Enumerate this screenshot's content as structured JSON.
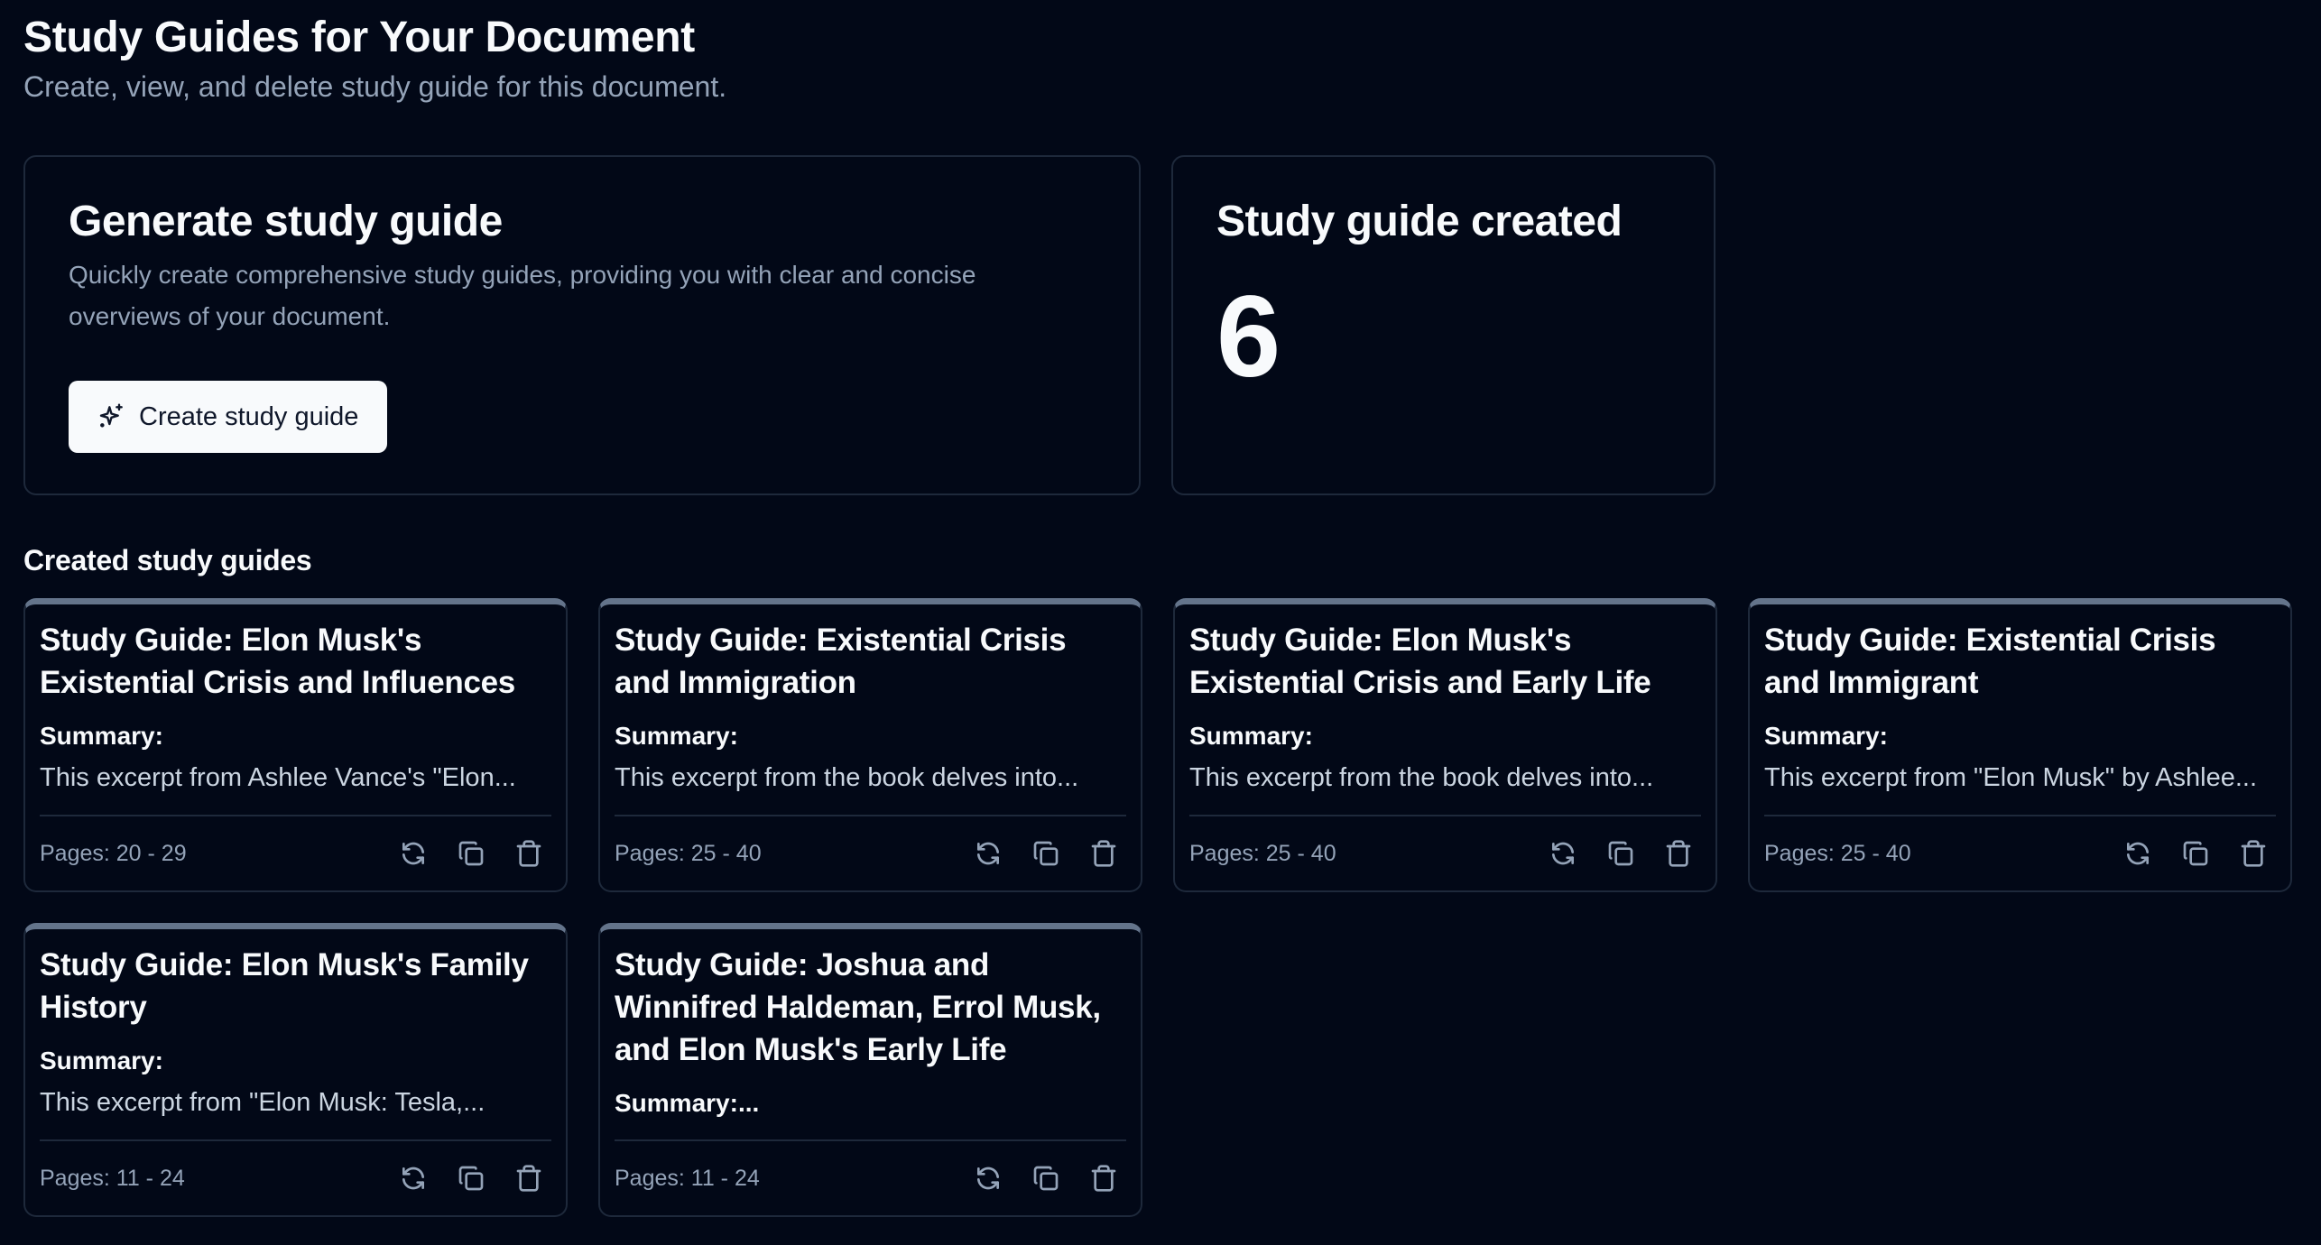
{
  "header": {
    "title": "Study Guides for Your Document",
    "subtitle": "Create, view, and delete study guide for this document."
  },
  "generate": {
    "title": "Generate study guide",
    "description": "Quickly create comprehensive study guides, providing you with clear and concise overviews of your document.",
    "button_label": "Create study guide",
    "button_icon": "sparkles-icon"
  },
  "stats": {
    "title": "Study guide created",
    "count": "6"
  },
  "list": {
    "heading": "Created study guides",
    "summary_label": "Summary:",
    "actions": [
      "regenerate-icon",
      "copy-icon",
      "delete-icon"
    ],
    "guides": [
      {
        "title": "Study Guide: Elon Musk's Existential Crisis and Influences",
        "summary_label": "Summary:",
        "summary": "This excerpt from Ashlee Vance's \"Elon...",
        "pages": "Pages: 20 - 29"
      },
      {
        "title": "Study Guide: Existential Crisis and Immigration",
        "summary_label": "Summary:",
        "summary": "This excerpt from the book delves into...",
        "pages": "Pages: 25 - 40"
      },
      {
        "title": "Study Guide: Elon Musk's Existential Crisis and Early Life",
        "summary_label": "Summary:",
        "summary": "This excerpt from the book delves into...",
        "pages": "Pages: 25 - 40"
      },
      {
        "title": "Study Guide: Existential Crisis and Immigrant",
        "summary_label": "Summary:",
        "summary": "This excerpt from \"Elon Musk\" by Ashlee...",
        "pages": "Pages: 25 - 40"
      },
      {
        "title": "Study Guide: Elon Musk's Family History",
        "summary_label": "Summary:",
        "summary": "This excerpt from \"Elon Musk: Tesla,...",
        "pages": "Pages: 11 - 24"
      },
      {
        "title": "Study Guide: Joshua and Winnifred Haldeman, Errol Musk, and Elon Musk's Early Life",
        "summary_label": "Summary:...",
        "summary": "",
        "pages": "Pages: 11 - 24"
      }
    ]
  },
  "colors": {
    "background": "#020817",
    "border": "#1e293b",
    "card_accent": "#64748b",
    "text_primary": "#f8fafc",
    "text_muted": "#94a3b8",
    "text_summary": "#cbd5e1",
    "button_bg": "#f8fafc",
    "button_text": "#0f172a"
  }
}
